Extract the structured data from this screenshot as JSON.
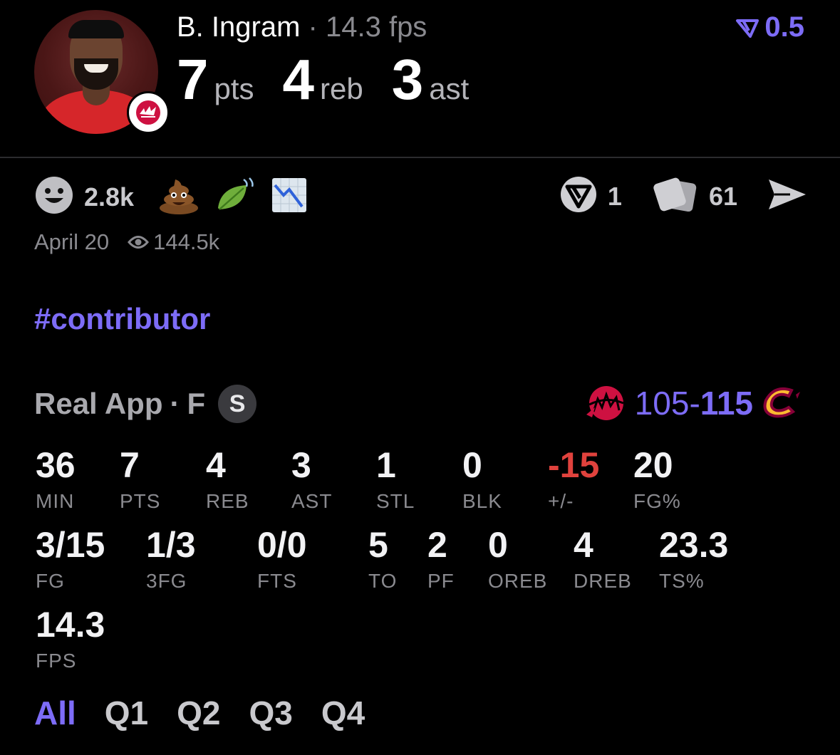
{
  "player": {
    "name": "B. Ingram",
    "separator": "·",
    "fps_text": "14.3 fps",
    "pts": "7",
    "pts_label": "pts",
    "reb": "4",
    "reb_label": "reb",
    "ast": "3",
    "ast_label": "ast",
    "team_logo": "raptors-logo-icon"
  },
  "odds": {
    "icon": "odds-funnel-icon",
    "value": "0.5"
  },
  "reactions": {
    "smile_count": "2.8k",
    "icons": [
      "smile-icon",
      "poop-emoji",
      "leaf-emoji",
      "chart-down-emoji"
    ]
  },
  "actions": {
    "vote_count": "1",
    "cards_count": "61",
    "icons": [
      "vote-icon",
      "cards-icon",
      "share-icon"
    ]
  },
  "meta": {
    "date": "April 20",
    "views": "144.5k"
  },
  "hashtag": "#contributor",
  "game": {
    "source": "Real App",
    "dot": "·",
    "status": "F",
    "badge": "S",
    "score_left": "105",
    "score_dash": "-",
    "score_right": "115",
    "home_logo": "raptors-logo-icon",
    "away_logo": "cavaliers-logo-icon"
  },
  "stats_row1": [
    {
      "value": "36",
      "label": "MIN"
    },
    {
      "value": "7",
      "label": "PTS"
    },
    {
      "value": "4",
      "label": "REB"
    },
    {
      "value": "3",
      "label": "AST"
    },
    {
      "value": "1",
      "label": "STL"
    },
    {
      "value": "0",
      "label": "BLK"
    },
    {
      "value": "-15",
      "label": "+/-"
    },
    {
      "value": "20",
      "label": "FG%"
    }
  ],
  "stats_row2": [
    {
      "value": "3/15",
      "label": "FG"
    },
    {
      "value": "1/3",
      "label": "3FG"
    },
    {
      "value": "0/0",
      "label": "FTS"
    },
    {
      "value": "5",
      "label": "TO"
    },
    {
      "value": "2",
      "label": "PF"
    },
    {
      "value": "0",
      "label": "OREB"
    },
    {
      "value": "4",
      "label": "DREB"
    },
    {
      "value": "23.3",
      "label": "TS%"
    }
  ],
  "stats_row3": [
    {
      "value": "14.3",
      "label": "FPS"
    }
  ],
  "tabs": [
    "All",
    "Q1",
    "Q2",
    "Q3",
    "Q4"
  ],
  "colors": {
    "accent": "#7d6cf7",
    "negative": "#e0423d",
    "background": "#000000"
  }
}
